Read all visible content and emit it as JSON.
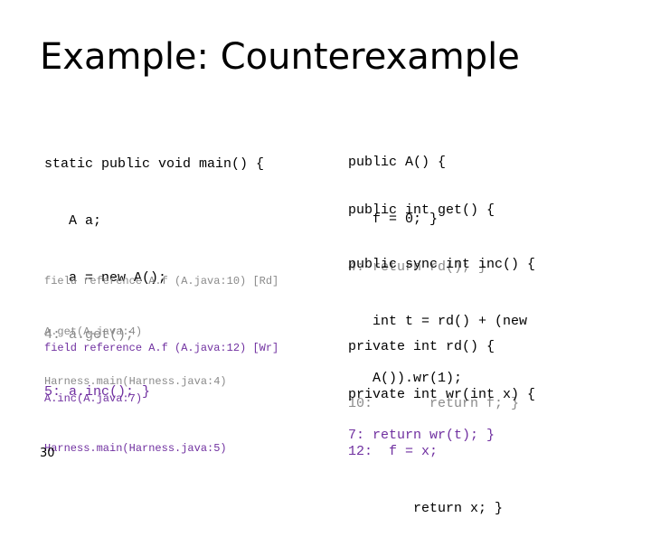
{
  "slide": {
    "title": "Example: Counterexample",
    "page_number": "30",
    "colors": {
      "default": "#000000",
      "read_highlight": "#8a8a8a",
      "write_highlight": "#7030a0"
    }
  },
  "left_code": {
    "lines": [
      {
        "text": "static public void main() {",
        "style": "black"
      },
      {
        "text": "   A a;",
        "style": "black"
      },
      {
        "text": "   a = new A();",
        "style": "black"
      },
      {
        "text": "4: a.get();",
        "style": "gray"
      },
      {
        "text": "5: a.inc(); }",
        "style": "purple"
      }
    ]
  },
  "traces": [
    {
      "style": "gray",
      "lines": [
        "field reference A.f (A.java:10) [Rd]",
        "A.get(A.java:4)",
        "Harness.main(Harness.java:4)"
      ]
    },
    {
      "style": "purple",
      "lines": [
        "field reference A.f (A.java:12) [Wr]",
        "A.inc(A.java:7)",
        "Harness.main(Harness.java:5)"
      ]
    }
  ],
  "right_code": {
    "blocks": [
      {
        "lines": [
          {
            "text": "public A() {",
            "style": "black"
          },
          {
            "text": "   f = 0; }",
            "style": "black"
          }
        ]
      },
      {
        "lines": [
          {
            "text": "public int get() {",
            "style": "black"
          },
          {
            "text": "4: return rd(); }",
            "style": "gray"
          }
        ]
      },
      {
        "lines": [
          {
            "text": "public sync int inc() {",
            "style": "black"
          },
          {
            "text": "   int t = rd() + (new",
            "style": "black"
          },
          {
            "text": "   A()).wr(1);",
            "style": "black"
          },
          {
            "text": "7: return wr(t); }",
            "style": "purple"
          }
        ]
      },
      {
        "lines": [
          {
            "text": "private int rd() {",
            "style": "black"
          },
          {
            "text": "10:       return f; }",
            "style": "gray"
          }
        ]
      },
      {
        "lines": [
          {
            "text": "private int wr(int x) {",
            "style": "black"
          },
          {
            "text": "12:  f = x;",
            "style": "purple"
          },
          {
            "text": "        return x; }",
            "style": "black"
          }
        ]
      }
    ]
  }
}
